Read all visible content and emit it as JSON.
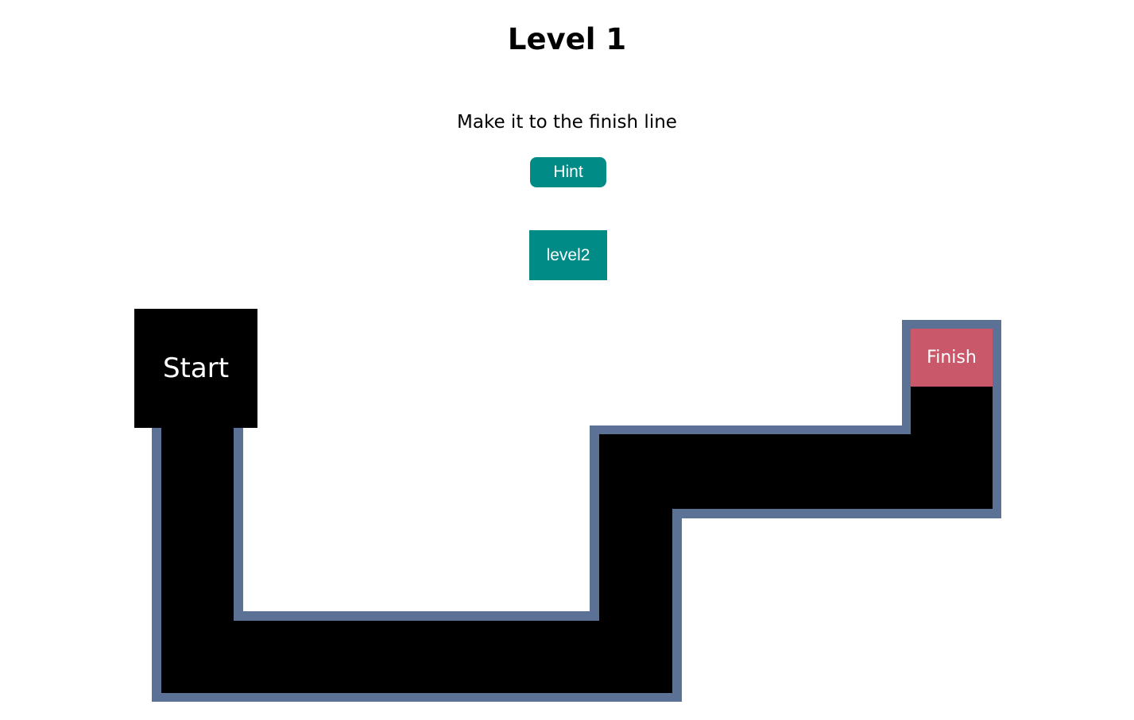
{
  "header": {
    "title": "Level 1",
    "instructions": "Make it to the finish line"
  },
  "controls": {
    "hint_label": "Hint",
    "next_level_label": "level2"
  },
  "maze": {
    "start_label": "Start",
    "finish_label": "Finish",
    "colors": {
      "path": "#000000",
      "wall": "#5b7196",
      "finish": "#c9586b",
      "button": "#008b87"
    }
  }
}
